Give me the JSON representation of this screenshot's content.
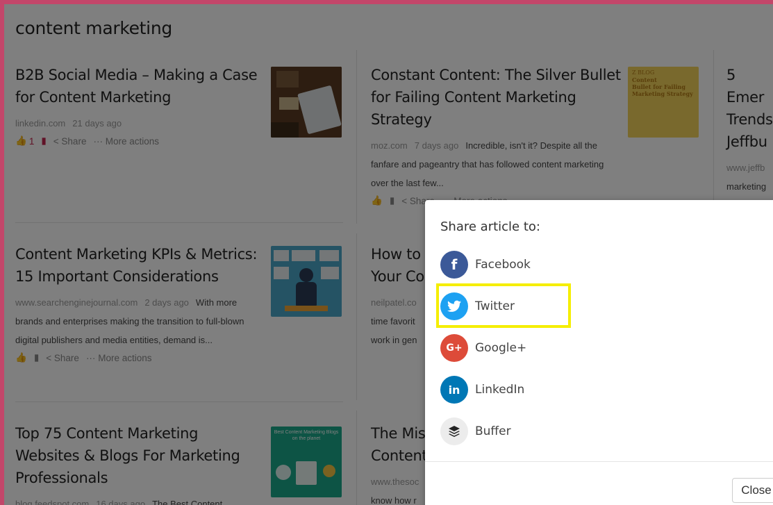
{
  "search": {
    "query": "content marketing"
  },
  "articles": [
    {
      "title": "B2B Social Media – Making a Case for Content Marketing",
      "domain": "linkedin.com",
      "age": "21 days ago",
      "snippet": "",
      "likes": "1",
      "share_label": "Share",
      "more_label": "More actions"
    },
    {
      "title": "Constant Content: The Silver Bullet for Failing Content Marketing Strategy",
      "domain": "moz.com",
      "age": "7 days ago",
      "snippet": "Incredible, isn't it? Despite all the fanfare and pageantry that has followed content marketing over the last few...",
      "share_label": "Share",
      "more_label": "More actions"
    },
    {
      "title": "5 Emer Trends Jeffbu",
      "domain": "www.jeffb",
      "snippet": "marketing strategy. I"
    },
    {
      "title": "Content Marketing KPIs & Metrics: 15 Important Considerations",
      "domain": "www.searchenginejournal.com",
      "age": "2 days ago",
      "snippet": "With more brands and enterprises making the transition to full-blown digital publishers and media entities, demand is...",
      "share_label": "Share",
      "more_label": "More actions"
    },
    {
      "title": "How to Your Co",
      "domain": "neilpatel.co",
      "snippet": "time favorit work in gen"
    },
    {
      "title": "Top 75 Content Marketing Websites & Blogs For Marketing Professionals",
      "domain": "blog.feedspot.com",
      "age": "16 days ago",
      "snippet": "The Best Content"
    },
    {
      "title": "The Mis Content",
      "domain": "www.thesoc",
      "snippet": "know how r"
    }
  ],
  "thumbnails": {
    "moz_text_line1": "Z BLOG",
    "moz_text_line2": "Content",
    "moz_text_line3": "Bullet for Failing",
    "moz_text_line4": "Marketing Strategy",
    "feedspot_text": "Best Content Marketing Blogs on the planet"
  },
  "share_modal": {
    "title": "Share article to:",
    "options": [
      {
        "label": "Facebook",
        "icon": "facebook-icon",
        "glyph": "f",
        "color": "#3b5998"
      },
      {
        "label": "Twitter",
        "icon": "twitter-icon",
        "glyph": "🐦",
        "color": "#1da1f2"
      },
      {
        "label": "Google+",
        "icon": "google-plus-icon",
        "glyph": "G+",
        "color": "#dd4b39"
      },
      {
        "label": "LinkedIn",
        "icon": "linkedin-icon",
        "glyph": "in",
        "color": "#0077b5"
      },
      {
        "label": "Buffer",
        "icon": "buffer-icon",
        "glyph": "≋",
        "color": "#ececec"
      }
    ],
    "close_label": "Close",
    "highlight_color": "#f5ee00"
  },
  "colors": {
    "frame": "#c3466a",
    "accent": "#c3244e"
  }
}
